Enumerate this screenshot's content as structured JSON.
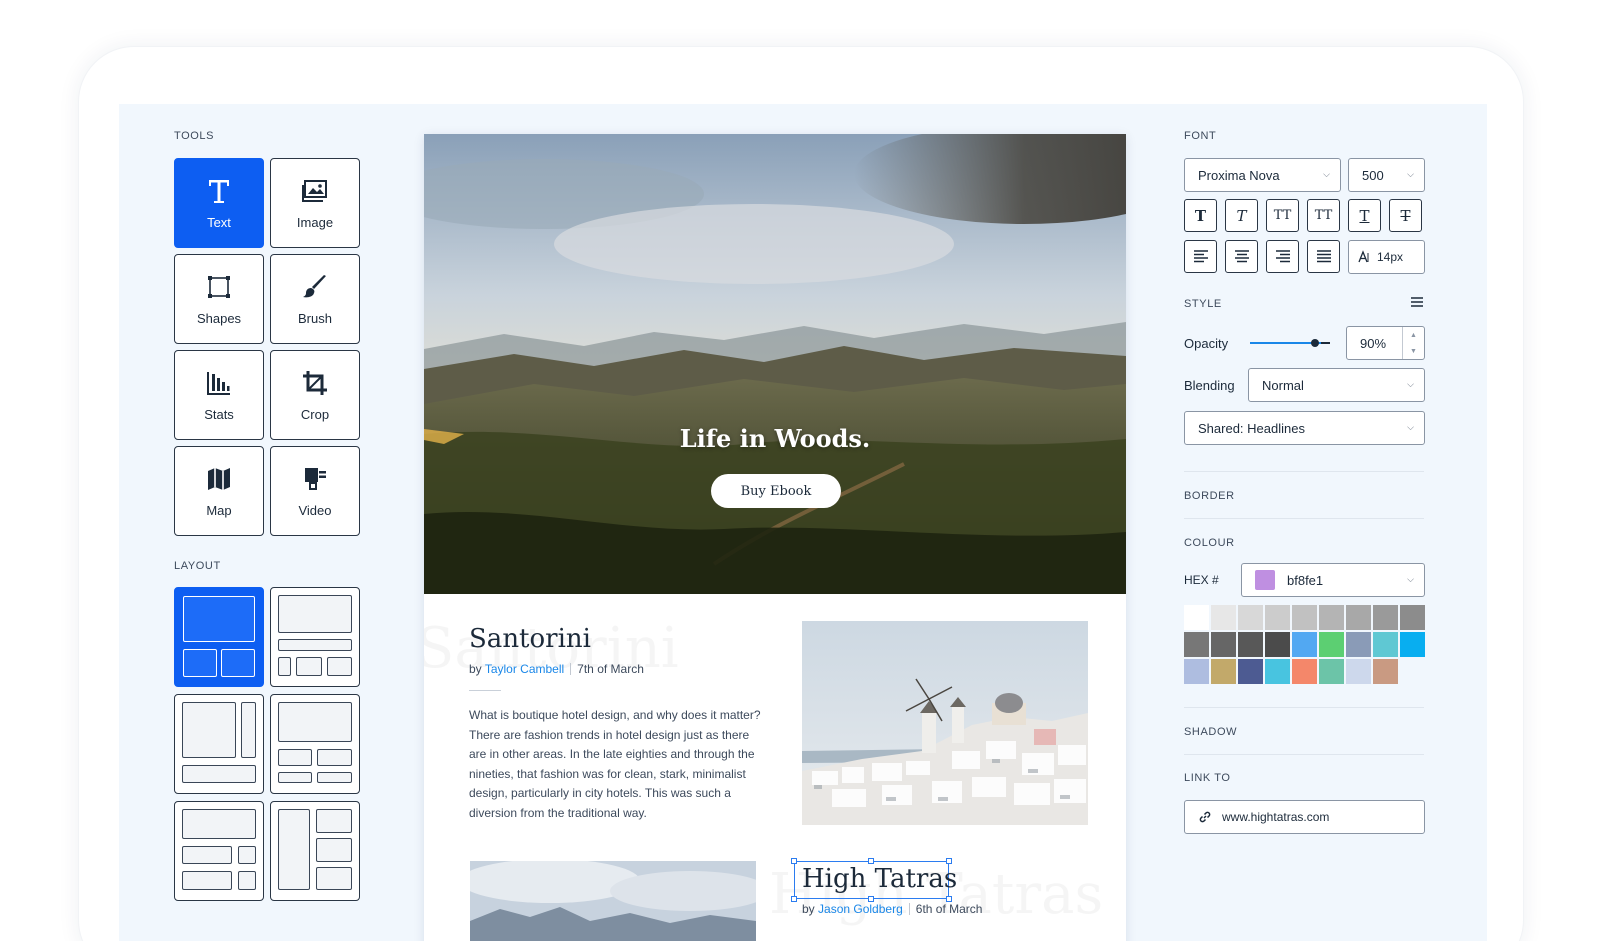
{
  "tools": {
    "label": "TOOLS",
    "items": [
      {
        "label": "Text",
        "icon": "text-icon"
      },
      {
        "label": "Image",
        "icon": "image-icon"
      },
      {
        "label": "Shapes",
        "icon": "shapes-icon"
      },
      {
        "label": "Brush",
        "icon": "brush-icon"
      },
      {
        "label": "Stats",
        "icon": "stats-icon"
      },
      {
        "label": "Crop",
        "icon": "crop-icon"
      },
      {
        "label": "Map",
        "icon": "map-icon"
      },
      {
        "label": "Video",
        "icon": "video-icon"
      }
    ],
    "active": "Text"
  },
  "layout": {
    "label": "LAYOUT",
    "options": [
      "layout-1",
      "layout-2",
      "layout-3",
      "layout-4",
      "layout-5",
      "layout-6"
    ],
    "active_index": 0
  },
  "canvas": {
    "hero": {
      "title": "Life in Woods.",
      "button": "Buy Ebook"
    },
    "articles": [
      {
        "title": "Santorini",
        "by": "by",
        "author": "Taylor Cambell",
        "date": "7th of March",
        "body": "What is boutique hotel design, and why does it matter? There are fashion trends in hotel design just as there are in other areas. In the late eighties and through the nineties, that fashion was for clean, stark, minimalist design, particularly in city hotels. This was such a diversion from the traditional way."
      },
      {
        "title": "High Tatras",
        "by": "by",
        "author": "Jason Goldberg",
        "date": "6th of March"
      }
    ]
  },
  "font": {
    "label": "FONT",
    "family": "Proxima Nova",
    "weight": "500",
    "style_buttons": [
      "T",
      "T",
      "TT",
      "TT",
      "T",
      "T"
    ],
    "size": "14px"
  },
  "style": {
    "label": "STYLE",
    "opacity_label": "Opacity",
    "opacity_value": "90%",
    "opacity": 0.9,
    "blending_label": "Blending",
    "blending_value": "Normal",
    "shared": "Shared: Headlines"
  },
  "border": {
    "label": "BORDER"
  },
  "colour": {
    "label": "COLOUR",
    "hex_label": "HEX #",
    "hex_value": "bf8fe1",
    "swatch": "#bf8fe1",
    "palette": [
      "#ffffff",
      "#e7e7e7",
      "#d8d8d8",
      "#cccccc",
      "#c1c1c1",
      "#b4b4b4",
      "#a8a8a8",
      "#9a9a9a",
      "#8c8c8c",
      "#777777",
      "#666666",
      "#585858",
      "#4b4b4b",
      "#52a8f2",
      "#5ccf72",
      "#8a9bb7",
      "#5fc8d3",
      "#08aef0",
      "#aebde0",
      "#c2a96a",
      "#4d5b92",
      "#48c4e0",
      "#f4876a",
      "#6cc4a8",
      "#cdd8ec",
      "#c99a82"
    ]
  },
  "shadow": {
    "label": "SHADOW"
  },
  "link": {
    "label": "LINK TO",
    "url": "www.hightatras.com"
  }
}
